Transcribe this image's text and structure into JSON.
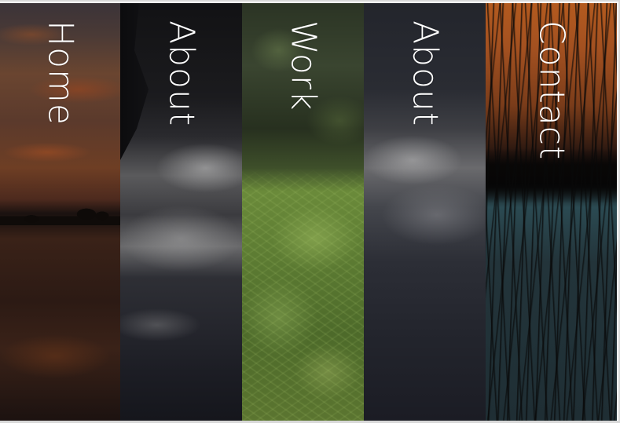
{
  "nav": {
    "panels": [
      {
        "label": "Home",
        "image": "sunset-lake"
      },
      {
        "label": "About",
        "image": "ocean-wave"
      },
      {
        "label": "Work",
        "image": "fern-forest"
      },
      {
        "label": "About",
        "image": "ocean-wave"
      },
      {
        "label": "Contact",
        "image": "reeds-sunset"
      }
    ]
  },
  "colors": {
    "label_text": "#ffffff",
    "frame_border": "#d8d8d8"
  }
}
